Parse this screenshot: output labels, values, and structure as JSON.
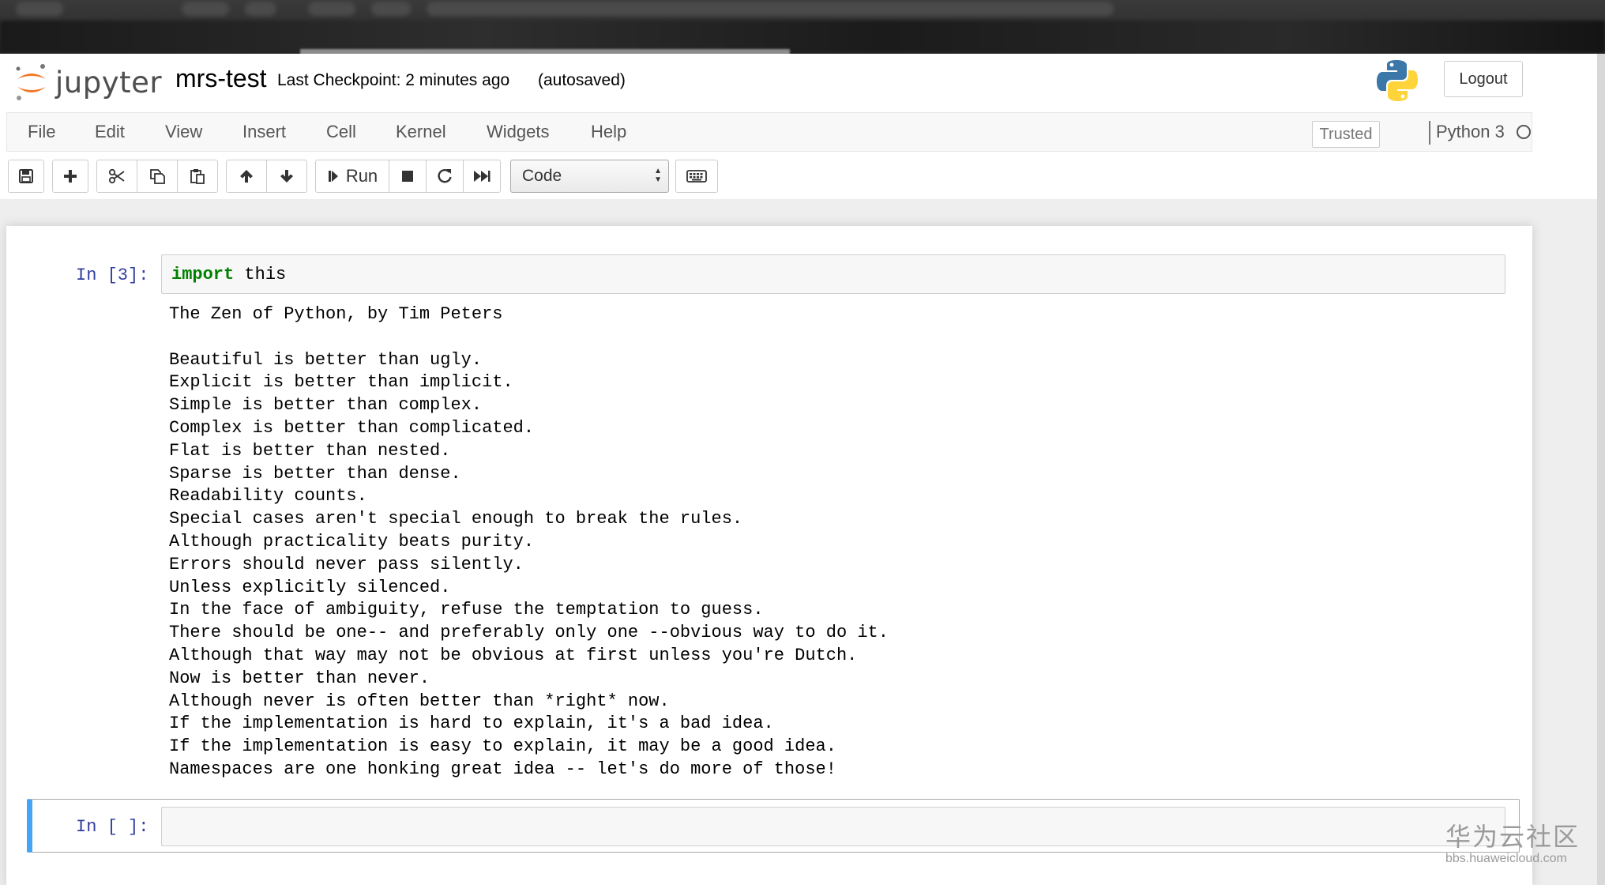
{
  "header": {
    "logo_text": "jupyter",
    "notebook_name": "mrs-test",
    "checkpoint_text": "Last Checkpoint: 2 minutes ago",
    "autosave_text": "(autosaved)",
    "logout_label": "Logout"
  },
  "menu": {
    "items": [
      {
        "label": "File"
      },
      {
        "label": "Edit"
      },
      {
        "label": "View"
      },
      {
        "label": "Insert"
      },
      {
        "label": "Cell"
      },
      {
        "label": "Kernel"
      },
      {
        "label": "Widgets"
      },
      {
        "label": "Help"
      }
    ],
    "trusted_label": "Trusted",
    "kernel_name": "Python 3"
  },
  "toolbar": {
    "icons": [
      "save-icon",
      "plus-icon",
      "scissors-icon",
      "copy-icon",
      "paste-icon",
      "arrow-up-icon",
      "arrow-down-icon",
      "step-forward-icon",
      "stop-icon",
      "refresh-icon",
      "fast-forward-icon",
      "keyboard-icon"
    ],
    "run_label": "Run",
    "cell_type_selected": "Code"
  },
  "cells": [
    {
      "prompt": "In [3]:",
      "source_keyword": "import",
      "source_rest": " this",
      "output_lines": [
        "The Zen of Python, by Tim Peters",
        "",
        "Beautiful is better than ugly.",
        "Explicit is better than implicit.",
        "Simple is better than complex.",
        "Complex is better than complicated.",
        "Flat is better than nested.",
        "Sparse is better than dense.",
        "Readability counts.",
        "Special cases aren't special enough to break the rules.",
        "Although practicality beats purity.",
        "Errors should never pass silently.",
        "Unless explicitly silenced.",
        "In the face of ambiguity, refuse the temptation to guess.",
        "There should be one-- and preferably only one --obvious way to do it.",
        "Although that way may not be obvious at first unless you're Dutch.",
        "Now is better than never.",
        "Although never is often better than *right* now.",
        "If the implementation is hard to explain, it's a bad idea.",
        "If the implementation is easy to explain, it may be a good idea.",
        "Namespaces are one honking great idea -- let's do more of those!"
      ]
    },
    {
      "prompt": "In [ ]:",
      "source": ""
    }
  ],
  "watermark": {
    "cn": "华为云社区",
    "url": "bbs.huaweicloud.com"
  },
  "colors": {
    "prompt_blue": "#303f9f",
    "keyword_green": "#008000",
    "selected_cell_accent": "#42a5f5",
    "jupyter_orange": "#f37726"
  }
}
